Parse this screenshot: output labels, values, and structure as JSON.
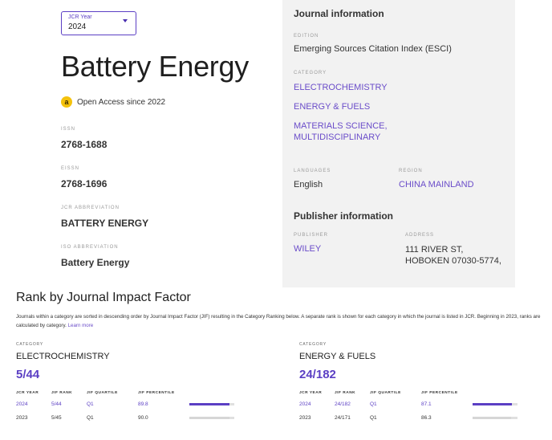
{
  "jcr_select": {
    "caption": "JCR Year",
    "value": "2024"
  },
  "journal": {
    "title": "Battery Energy",
    "open_access": "Open Access since 2022",
    "oa_icon_glyph": "a",
    "fields": [
      {
        "label": "ISSN",
        "value": "2768-1688"
      },
      {
        "label": "EISSN",
        "value": "2768-1696"
      },
      {
        "label": "JCR ABBREVIATION",
        "value": "BATTERY ENERGY"
      },
      {
        "label": "ISO ABBREVIATION",
        "value": "Battery Energy"
      }
    ]
  },
  "info_panel": {
    "heading": "Journal information",
    "edition_label": "EDITION",
    "edition_value": "Emerging Sources Citation Index (ESCI)",
    "category_label": "CATEGORY",
    "categories": [
      "ELECTROCHEMISTRY",
      "ENERGY & FUELS",
      "MATERIALS SCIENCE, MULTIDISCIPLINARY"
    ],
    "languages_label": "LANGUAGES",
    "languages_value": "English",
    "region_label": "REGION",
    "region_value": "CHINA MAINLAND",
    "publisher_heading": "Publisher information",
    "publisher_label": "PUBLISHER",
    "publisher_value": "WILEY",
    "address_label": "ADDRESS",
    "address_value": "111 RIVER ST, HOBOKEN 07030-5774,"
  },
  "rank": {
    "heading": "Rank by Journal Impact Factor",
    "description": "Journals within a category are sorted in descending order by Journal Impact Factor (JIF) resulting in the Category Ranking below. A separate rank is shown for each category in which the journal is listed in JCR. Beginning in 2023, ranks are calculated by category.",
    "learn_more": "Learn more",
    "columns": [
      "JCR YEAR",
      "JIF RANK",
      "JIF QUARTILE",
      "JIF PERCENTILE"
    ],
    "category_label": "CATEGORY",
    "categories": [
      {
        "name": "ELECTROCHEMISTRY",
        "rank": "5/44",
        "rows": [
          {
            "year": "2024",
            "rank": "5/44",
            "quartile": "Q1",
            "percentile": "89.8"
          },
          {
            "year": "2023",
            "rank": "5/45",
            "quartile": "Q1",
            "percentile": "90.0"
          }
        ]
      },
      {
        "name": "ENERGY & FUELS",
        "rank": "24/182",
        "rows": [
          {
            "year": "2024",
            "rank": "24/182",
            "quartile": "Q1",
            "percentile": "87.1"
          },
          {
            "year": "2023",
            "rank": "24/171",
            "quartile": "Q1",
            "percentile": "86.3"
          }
        ]
      }
    ]
  },
  "colors": {
    "accent": "#5b3fc4",
    "bar_current": "#5b3fc4",
    "bar_previous": "#d6d6d6",
    "oa_badge": "#f4c20d"
  }
}
